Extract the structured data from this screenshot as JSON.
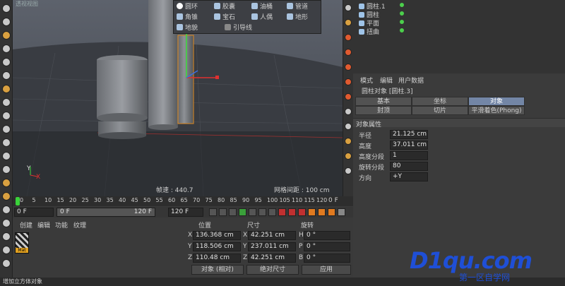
{
  "viewport": {
    "title": "透视视图",
    "fps_text": "帧速 : 440.7",
    "grid_text": "网格间距 : 100 cm",
    "axis_y": "Y",
    "axis_x": "X"
  },
  "primitive_menu": {
    "items": [
      {
        "label": "圆环",
        "icon": "torus-icon"
      },
      {
        "label": "胶囊",
        "icon": "capsule-icon"
      },
      {
        "label": "油桶",
        "icon": "oil-tank-icon"
      },
      {
        "label": "管道",
        "icon": "tube-icon"
      },
      {
        "label": "角锥",
        "icon": "pyramid-icon"
      },
      {
        "label": "宝石",
        "icon": "gem-icon"
      },
      {
        "label": "人偶",
        "icon": "figure-icon"
      },
      {
        "label": "地形",
        "icon": "landscape-icon"
      },
      {
        "label": "地貌",
        "icon": "relief-icon"
      },
      {
        "label": "引导线",
        "icon": "guide-icon"
      }
    ]
  },
  "object_manager": {
    "items": [
      {
        "label": "圆柱.1"
      },
      {
        "label": "圆柱"
      },
      {
        "label": "平面"
      },
      {
        "label": "扭曲"
      }
    ]
  },
  "attributes": {
    "menu": [
      "模式",
      "编辑",
      "用户数据"
    ],
    "object_title": "圆柱对象 [圆柱.3]",
    "tabs_row1": [
      "基本",
      "坐标",
      "对象"
    ],
    "tabs_row2": [
      "封顶",
      "切片",
      "平滑着色(Phong)"
    ],
    "active_tab": "对象",
    "section_title": "对象属性",
    "props": [
      {
        "label": "半径",
        "value": "21.125 cm"
      },
      {
        "label": "高度",
        "value": "37.011 cm"
      },
      {
        "label": "高度分段",
        "value": "1"
      },
      {
        "label": "旋转分段",
        "value": "80"
      },
      {
        "label": "方向",
        "value": "+Y"
      }
    ]
  },
  "timeline": {
    "ticks": [
      "0",
      "5",
      "10",
      "15",
      "20",
      "25",
      "30",
      "35",
      "40",
      "45",
      "50",
      "55",
      "60",
      "65",
      "70",
      "75",
      "80",
      "85",
      "90",
      "95",
      "100",
      "105",
      "110",
      "115",
      "120"
    ],
    "end_label": "0 F",
    "current_frame": "0 F",
    "start_frame": "0 F",
    "end_frame_slider": "120 F",
    "end_frame": "120 F"
  },
  "material_manager": {
    "menu": [
      "创建",
      "编辑",
      "功能",
      "纹理"
    ],
    "material_label": "Mat"
  },
  "coordinates": {
    "headers": [
      "位置",
      "尺寸",
      "旋转"
    ],
    "rows": [
      {
        "axis_p": "X",
        "pos": "136.368 cm",
        "axis_s": "X",
        "size": "42.251 cm",
        "axis_r": "H",
        "rot": "0 °"
      },
      {
        "axis_p": "Y",
        "pos": "118.506 cm",
        "axis_s": "Y",
        "size": "237.011 cm",
        "axis_r": "P",
        "rot": "0 °"
      },
      {
        "axis_p": "Z",
        "pos": "110.48 cm",
        "axis_s": "Z",
        "size": "42.251 cm",
        "axis_r": "B",
        "rot": "0 °"
      }
    ],
    "mode_select": "对象 (相对)",
    "size_select": "绝对尺寸",
    "apply_label": "应用"
  },
  "status": {
    "text": "增加立方体对象"
  },
  "watermark": {
    "brand": "D1qu.com",
    "tagline": "第一区自学网"
  }
}
